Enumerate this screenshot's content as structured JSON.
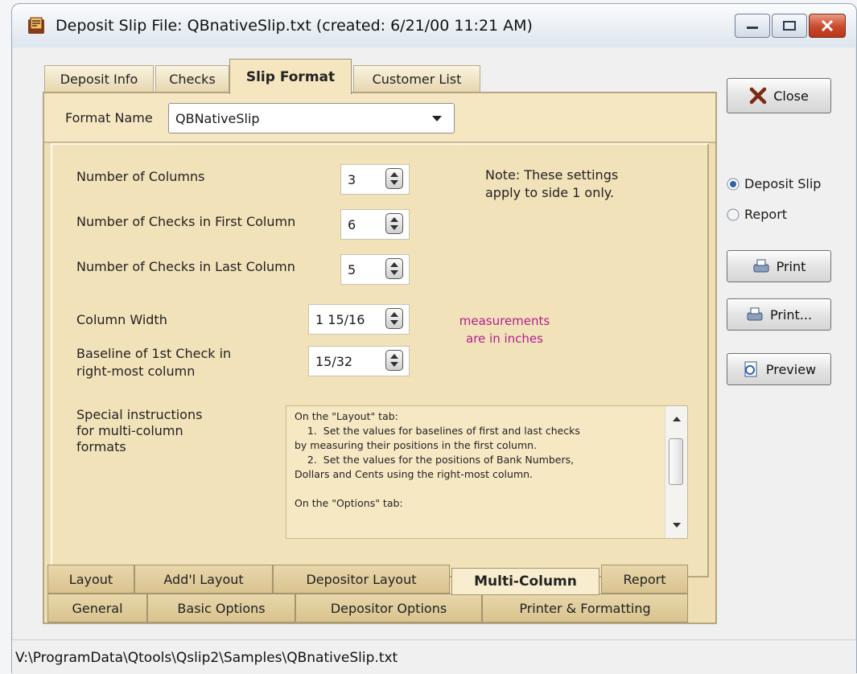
{
  "window": {
    "title": "Deposit Slip File:  QBnativeSlip.txt  (created: 6/21/00 11:21 AM)"
  },
  "top_tabs": [
    {
      "label": "Deposit Info",
      "active": false
    },
    {
      "label": "Checks",
      "active": false
    },
    {
      "label": "Slip Format",
      "active": true
    },
    {
      "label": "Customer List",
      "active": false
    }
  ],
  "format": {
    "label": "Format Name",
    "value": "QBNativeSlip"
  },
  "settings": {
    "columns_label": "Number of Columns",
    "columns_value": "3",
    "first_label": "Number of Checks in First Column",
    "first_value": "6",
    "last_label": "Number of Checks in Last Column",
    "last_value": "5",
    "width_label": "Column Width",
    "width_value": "1 15/16",
    "baseline_label_1": "Baseline of 1st Check in",
    "baseline_label_2": "right-most column",
    "baseline_value": "15/32",
    "note_1": "Note: These settings",
    "note_2": "apply to side 1 only.",
    "measure_1": "measurements",
    "measure_2": "are in inches"
  },
  "special": {
    "label_1": "Special instructions",
    "label_2": "for multi-column",
    "label_3": "formats",
    "lines": [
      "On the \"Layout\" tab:",
      "    1.  Set the values for baselines of first and last checks",
      "by measuring their positions in the first column.",
      "    2.  Set the values for the positions of Bank Numbers,",
      "Dollars and Cents using the right-most column.",
      "",
      "On the \"Options\" tab:"
    ]
  },
  "bottom_tabs_row1": [
    {
      "label": "Layout",
      "active": false
    },
    {
      "label": "Add'l Layout",
      "active": false
    },
    {
      "label": "Depositor Layout",
      "active": false
    },
    {
      "label": "Multi-Column",
      "active": true
    },
    {
      "label": "Report",
      "active": false
    }
  ],
  "bottom_tabs_row2": [
    {
      "label": "General"
    },
    {
      "label": "Basic Options"
    },
    {
      "label": "Depositor Options"
    },
    {
      "label": "Printer & Formatting"
    }
  ],
  "right": {
    "close_label": "Close",
    "radio_deposit": "Deposit Slip",
    "radio_report": "Report",
    "print_label": "Print",
    "print_dialog_label": "Print...",
    "preview_label": "Preview"
  },
  "status": {
    "path": "V:\\ProgramData\\Qtools\\Qslip2\\Samples\\QBnativeSlip.txt"
  },
  "colors": {
    "panel": "#f0dfb5",
    "measure_text": "#b0208c"
  }
}
